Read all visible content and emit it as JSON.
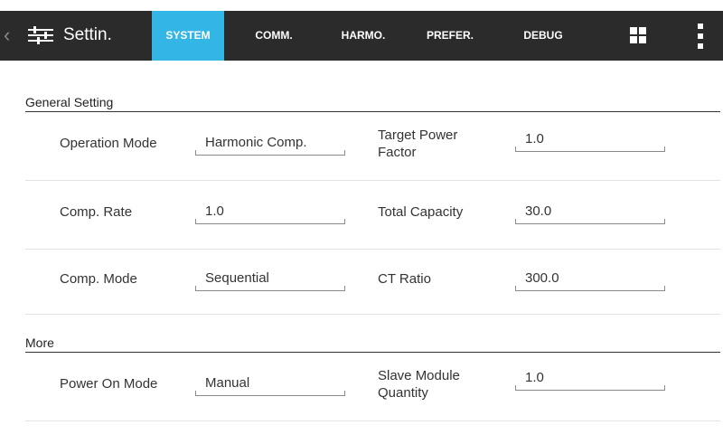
{
  "header": {
    "title": "Settin.",
    "tabs": [
      {
        "label": "SYSTEM",
        "active": true
      },
      {
        "label": "COMM."
      },
      {
        "label": "HARMO."
      },
      {
        "label": "PREFER."
      },
      {
        "label": "DEBUG"
      }
    ],
    "icons": [
      "back-chevron-icon",
      "settings-sliders-icon",
      "grid-icon",
      "overflow-menu-icon"
    ],
    "colors": {
      "bar": "#2b2b2b",
      "active_tab": "#33b5e5"
    }
  },
  "general": {
    "title": "General Setting",
    "operation_mode": {
      "label": "Operation Mode",
      "value": "Harmonic Comp."
    },
    "target_pf": {
      "label_line1": "Target Power",
      "label_line2": "Factor",
      "value": "1.0"
    },
    "comp_rate": {
      "label": "Comp. Rate",
      "value": "1.0"
    },
    "total_capacity": {
      "label": "Total Capacity",
      "value": "30.0"
    },
    "comp_mode": {
      "label": "Comp. Mode",
      "value": "Sequential"
    },
    "ct_ratio": {
      "label": "CT Ratio",
      "value": "300.0"
    }
  },
  "more": {
    "title": "More",
    "power_on_mode": {
      "label": "Power On Mode",
      "value": "Manual"
    },
    "slave_qty": {
      "label_line1": "Slave Module",
      "label_line2": "Quantity",
      "value": "1.0"
    }
  }
}
